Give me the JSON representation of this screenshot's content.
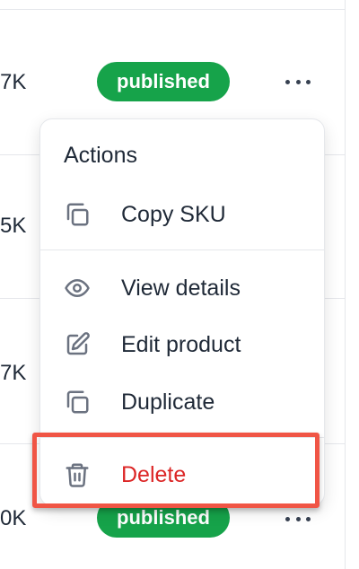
{
  "table": {
    "rows": [
      {
        "value": "7K",
        "status": "published"
      },
      {
        "value": "5K"
      },
      {
        "value": "7K"
      },
      {
        "value": "0K",
        "status": "published"
      }
    ]
  },
  "menu": {
    "title": "Actions",
    "items": [
      {
        "label": "Copy SKU",
        "icon": "copy-icon"
      },
      {
        "label": "View details",
        "icon": "eye-icon"
      },
      {
        "label": "Edit product",
        "icon": "pencil-icon"
      },
      {
        "label": "Duplicate",
        "icon": "copy-icon"
      },
      {
        "label": "Delete",
        "icon": "trash-icon",
        "color": "#dc2626"
      }
    ]
  },
  "colors": {
    "badge": "#16a34a",
    "highlight": "#f05545",
    "danger": "#dc2626"
  }
}
